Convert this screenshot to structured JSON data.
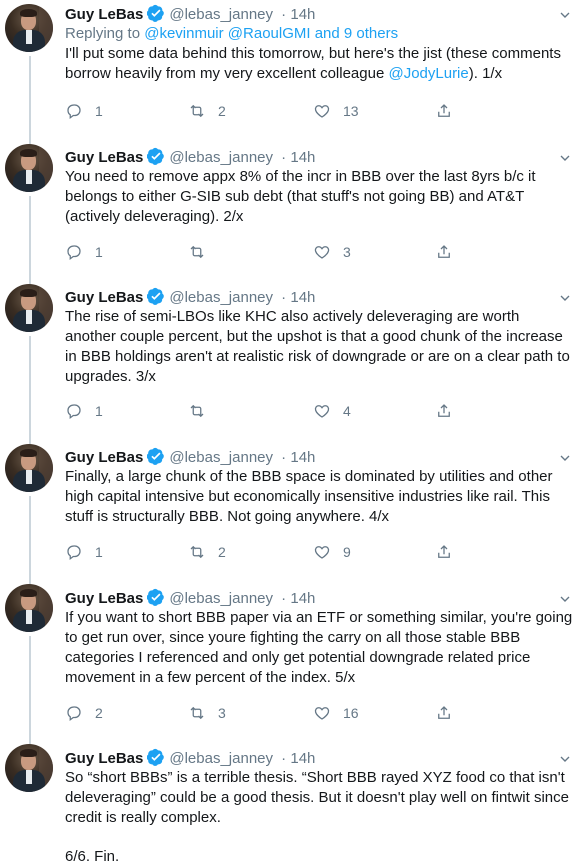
{
  "tweets": [
    {
      "name": "Guy LeBas",
      "handle": "@lebas_janney",
      "time": "14h",
      "replying_prefix": "Replying to ",
      "replying_links": "@kevinmuir @RaoulGMI and 9 others",
      "text_before_link": "I'll put some data behind this tomorrow, but here's the jist (these comments borrow heavily from my very excellent colleague ",
      "mention": "@JodyLurie",
      "text_after_link": "). 1/x",
      "replies": "1",
      "retweets": "2",
      "likes": "13"
    },
    {
      "name": "Guy LeBas",
      "handle": "@lebas_janney",
      "time": "14h",
      "text": "You need to remove appx 8% of the incr in BBB over the last 8yrs b/c it belongs to either G-SIB sub debt (that stuff's not going BB) and AT&T (actively deleveraging).  2/x",
      "replies": "1",
      "retweets": "",
      "likes": "3"
    },
    {
      "name": "Guy LeBas",
      "handle": "@lebas_janney",
      "time": "14h",
      "text": "The rise of semi-LBOs like KHC also actively deleveraging are worth another couple percent, but the upshot is that a good chunk of the increase in BBB holdings aren't at realistic risk of downgrade or are on a clear path to upgrades.  3/x",
      "replies": "1",
      "retweets": "",
      "likes": "4"
    },
    {
      "name": "Guy LeBas",
      "handle": "@lebas_janney",
      "time": "14h",
      "text": "Finally, a large chunk of the BBB space is dominated by utilities and other high capital intensive but economically insensitive industries like rail.  This stuff is structurally BBB.  Not going anywhere.  4/x",
      "replies": "1",
      "retweets": "2",
      "likes": "9"
    },
    {
      "name": "Guy LeBas",
      "handle": "@lebas_janney",
      "time": "14h",
      "text": "If you want to short BBB paper via an ETF or something similar, you're going to get run over, since youre fighting the carry on all those stable BBB categories I referenced and only get potential downgrade related price movement in a few percent of the index. 5/x",
      "replies": "2",
      "retweets": "3",
      "likes": "16"
    },
    {
      "name": "Guy LeBas",
      "handle": "@lebas_janney",
      "time": "14h",
      "text": "So “short BBBs” is a terrible thesis.  “Short BBB rayed XYZ food co that isn't deleveraging” could be a good thesis.  But it doesn't play well on fintwit since credit is really complex.",
      "text2": "6/6. Fin."
    }
  ],
  "icons": {
    "verified": "verified-badge-icon",
    "caret": "chevron-down-icon",
    "reply": "reply-icon",
    "retweet": "retweet-icon",
    "like": "heart-icon",
    "share": "share-icon"
  },
  "colors": {
    "accent": "#1da1f2",
    "muted": "#657786",
    "text": "#14171a",
    "thread": "#ccd6dd"
  }
}
